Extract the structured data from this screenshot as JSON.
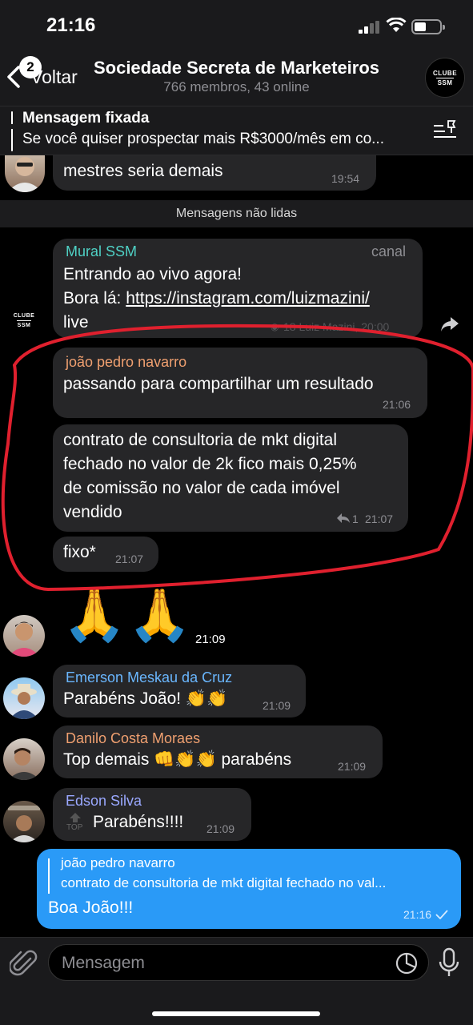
{
  "status_bar": {
    "time": "21:16"
  },
  "header": {
    "back_badge": "2",
    "back_label": "Voltar",
    "title": "Sociedade Secreta de Marketeiros",
    "subtitle": "766 membros, 43 online",
    "avatar_logo": [
      "CLUBE",
      "SSM"
    ]
  },
  "pinned": {
    "title": "Mensagem fixada",
    "text": "Se você quiser prospectar mais R$3000/mês em co..."
  },
  "chat": {
    "unread_label": "Mensagens não lidas",
    "messages": [
      {
        "text": "mestres seria demais",
        "time": "19:54"
      },
      {
        "sender": "Mural SSM",
        "tag": "canal",
        "line1": "Entrando ao vivo agora!",
        "line2_prefix": "Bora lá: ",
        "link": "https://instagram.com/luizmazini/",
        "line3": "live",
        "meta": "18 Luiz Mazini, 20:00",
        "logo": [
          "CLUBE",
          "SSM"
        ]
      },
      {
        "sender": "joão pedro navarro",
        "text": "passando para compartilhar um resultado",
        "time": "21:06"
      },
      {
        "lines": [
          "contrato de consultoria de mkt digital",
          "fechado no valor de 2k fico mais 0,25%",
          "de comissão no valor de cada imóvel",
          "vendido"
        ],
        "replies": "1",
        "time": "21:07"
      },
      {
        "text": "fixo*",
        "time": "21:07"
      },
      {
        "emoji": "🙏🙏",
        "time": "21:09"
      },
      {
        "sender": "Emerson Meskau da Cruz",
        "text": "Parabéns João! 👏👏",
        "time": "21:09"
      },
      {
        "sender": "Danilo Costa Moraes",
        "text": "Top demais 👊👏👏 parabéns",
        "time": "21:09"
      },
      {
        "sender": "Edson Silva",
        "top_label": "TOP",
        "text": "Parabéns!!!!",
        "time": "21:09"
      }
    ],
    "outgoing": {
      "quote_name": "joão pedro navarro",
      "quote_text": "contrato de consultoria de mkt digital fechado no val...",
      "text": "Boa João!!!",
      "time": "21:16"
    }
  },
  "input": {
    "placeholder": "Mensagem"
  },
  "colors": {
    "accent_blue": "#2a9af7",
    "mural_name": "#4fd1c5",
    "joao_name": "#f0a070",
    "emerson_name": "#6ab7ff",
    "danilo_name": "#f0a070",
    "edson_name": "#9aa8ff",
    "highlight_stroke": "#e0202e"
  }
}
